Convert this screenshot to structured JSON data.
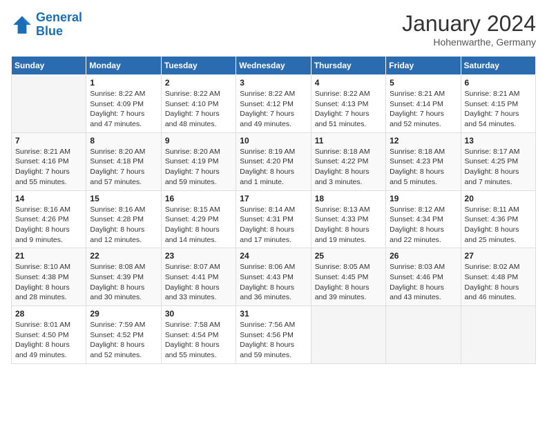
{
  "header": {
    "logo_line1": "General",
    "logo_line2": "Blue",
    "month": "January 2024",
    "location": "Hohenwarthe, Germany"
  },
  "weekdays": [
    "Sunday",
    "Monday",
    "Tuesday",
    "Wednesday",
    "Thursday",
    "Friday",
    "Saturday"
  ],
  "weeks": [
    [
      {
        "day": "",
        "info": ""
      },
      {
        "day": "1",
        "info": "Sunrise: 8:22 AM\nSunset: 4:09 PM\nDaylight: 7 hours\nand 47 minutes."
      },
      {
        "day": "2",
        "info": "Sunrise: 8:22 AM\nSunset: 4:10 PM\nDaylight: 7 hours\nand 48 minutes."
      },
      {
        "day": "3",
        "info": "Sunrise: 8:22 AM\nSunset: 4:12 PM\nDaylight: 7 hours\nand 49 minutes."
      },
      {
        "day": "4",
        "info": "Sunrise: 8:22 AM\nSunset: 4:13 PM\nDaylight: 7 hours\nand 51 minutes."
      },
      {
        "day": "5",
        "info": "Sunrise: 8:21 AM\nSunset: 4:14 PM\nDaylight: 7 hours\nand 52 minutes."
      },
      {
        "day": "6",
        "info": "Sunrise: 8:21 AM\nSunset: 4:15 PM\nDaylight: 7 hours\nand 54 minutes."
      }
    ],
    [
      {
        "day": "7",
        "info": "Sunrise: 8:21 AM\nSunset: 4:16 PM\nDaylight: 7 hours\nand 55 minutes."
      },
      {
        "day": "8",
        "info": "Sunrise: 8:20 AM\nSunset: 4:18 PM\nDaylight: 7 hours\nand 57 minutes."
      },
      {
        "day": "9",
        "info": "Sunrise: 8:20 AM\nSunset: 4:19 PM\nDaylight: 7 hours\nand 59 minutes."
      },
      {
        "day": "10",
        "info": "Sunrise: 8:19 AM\nSunset: 4:20 PM\nDaylight: 8 hours\nand 1 minute."
      },
      {
        "day": "11",
        "info": "Sunrise: 8:18 AM\nSunset: 4:22 PM\nDaylight: 8 hours\nand 3 minutes."
      },
      {
        "day": "12",
        "info": "Sunrise: 8:18 AM\nSunset: 4:23 PM\nDaylight: 8 hours\nand 5 minutes."
      },
      {
        "day": "13",
        "info": "Sunrise: 8:17 AM\nSunset: 4:25 PM\nDaylight: 8 hours\nand 7 minutes."
      }
    ],
    [
      {
        "day": "14",
        "info": "Sunrise: 8:16 AM\nSunset: 4:26 PM\nDaylight: 8 hours\nand 9 minutes."
      },
      {
        "day": "15",
        "info": "Sunrise: 8:16 AM\nSunset: 4:28 PM\nDaylight: 8 hours\nand 12 minutes."
      },
      {
        "day": "16",
        "info": "Sunrise: 8:15 AM\nSunset: 4:29 PM\nDaylight: 8 hours\nand 14 minutes."
      },
      {
        "day": "17",
        "info": "Sunrise: 8:14 AM\nSunset: 4:31 PM\nDaylight: 8 hours\nand 17 minutes."
      },
      {
        "day": "18",
        "info": "Sunrise: 8:13 AM\nSunset: 4:33 PM\nDaylight: 8 hours\nand 19 minutes."
      },
      {
        "day": "19",
        "info": "Sunrise: 8:12 AM\nSunset: 4:34 PM\nDaylight: 8 hours\nand 22 minutes."
      },
      {
        "day": "20",
        "info": "Sunrise: 8:11 AM\nSunset: 4:36 PM\nDaylight: 8 hours\nand 25 minutes."
      }
    ],
    [
      {
        "day": "21",
        "info": "Sunrise: 8:10 AM\nSunset: 4:38 PM\nDaylight: 8 hours\nand 28 minutes."
      },
      {
        "day": "22",
        "info": "Sunrise: 8:08 AM\nSunset: 4:39 PM\nDaylight: 8 hours\nand 30 minutes."
      },
      {
        "day": "23",
        "info": "Sunrise: 8:07 AM\nSunset: 4:41 PM\nDaylight: 8 hours\nand 33 minutes."
      },
      {
        "day": "24",
        "info": "Sunrise: 8:06 AM\nSunset: 4:43 PM\nDaylight: 8 hours\nand 36 minutes."
      },
      {
        "day": "25",
        "info": "Sunrise: 8:05 AM\nSunset: 4:45 PM\nDaylight: 8 hours\nand 39 minutes."
      },
      {
        "day": "26",
        "info": "Sunrise: 8:03 AM\nSunset: 4:46 PM\nDaylight: 8 hours\nand 43 minutes."
      },
      {
        "day": "27",
        "info": "Sunrise: 8:02 AM\nSunset: 4:48 PM\nDaylight: 8 hours\nand 46 minutes."
      }
    ],
    [
      {
        "day": "28",
        "info": "Sunrise: 8:01 AM\nSunset: 4:50 PM\nDaylight: 8 hours\nand 49 minutes."
      },
      {
        "day": "29",
        "info": "Sunrise: 7:59 AM\nSunset: 4:52 PM\nDaylight: 8 hours\nand 52 minutes."
      },
      {
        "day": "30",
        "info": "Sunrise: 7:58 AM\nSunset: 4:54 PM\nDaylight: 8 hours\nand 55 minutes."
      },
      {
        "day": "31",
        "info": "Sunrise: 7:56 AM\nSunset: 4:56 PM\nDaylight: 8 hours\nand 59 minutes."
      },
      {
        "day": "",
        "info": ""
      },
      {
        "day": "",
        "info": ""
      },
      {
        "day": "",
        "info": ""
      }
    ]
  ]
}
